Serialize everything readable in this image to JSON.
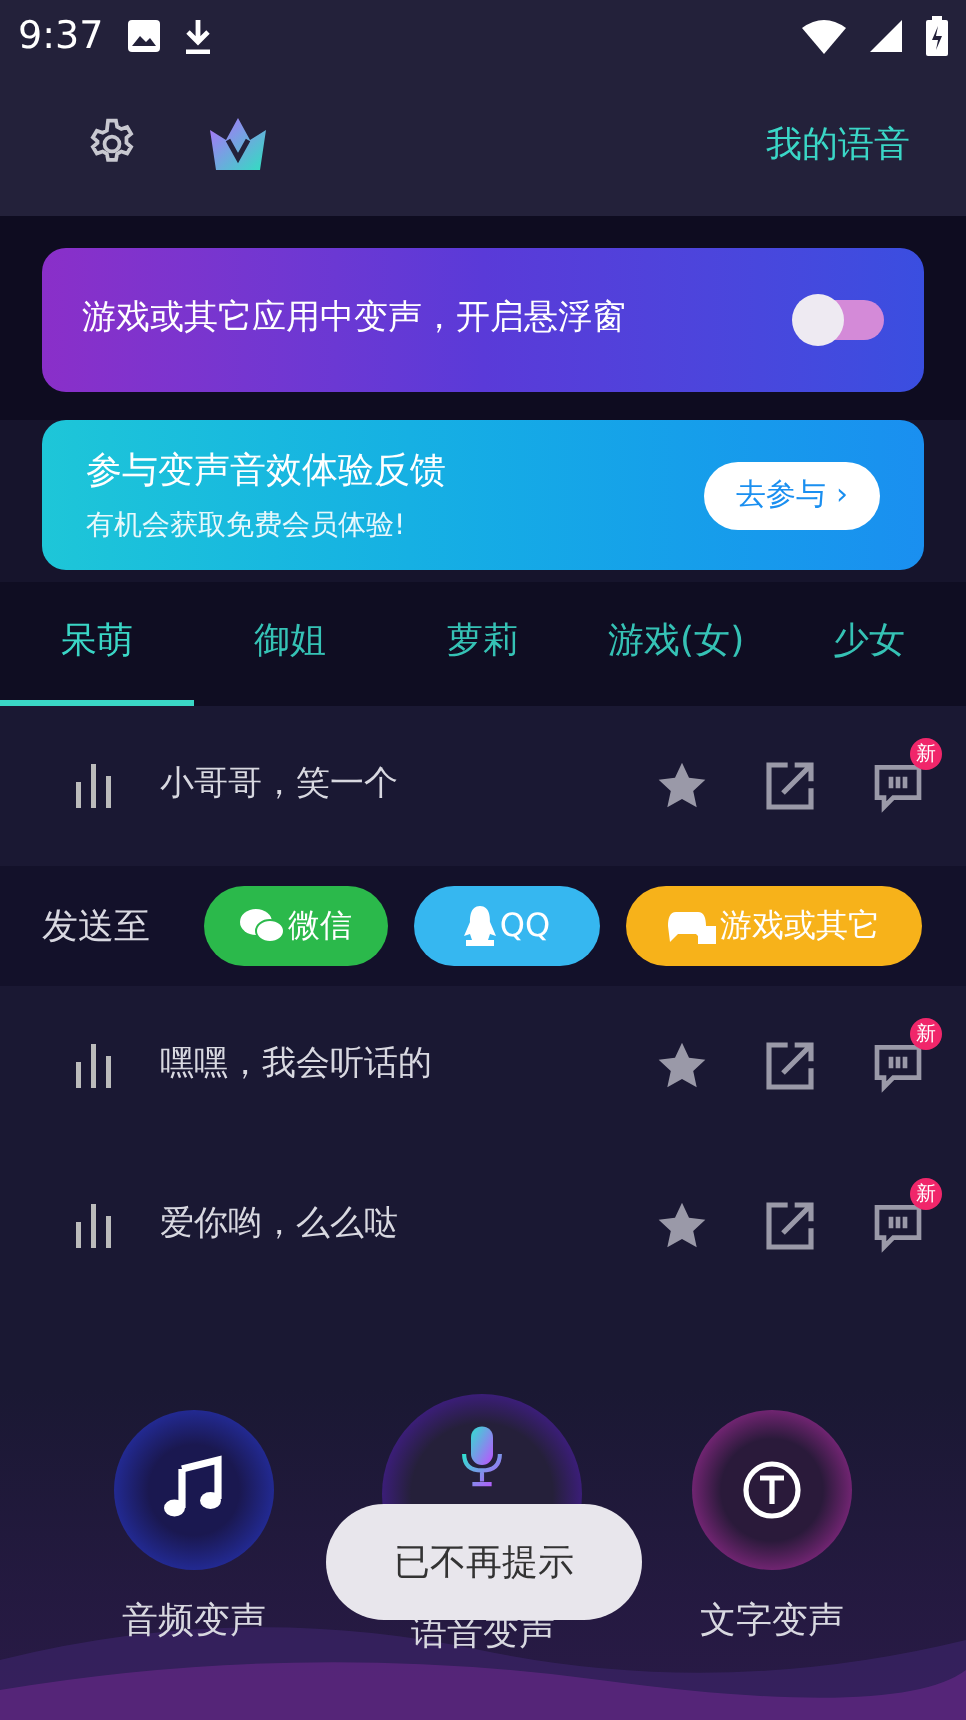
{
  "status_bar": {
    "time": "9:37"
  },
  "header": {
    "my_voice": "我的语音"
  },
  "float_banner": {
    "text": "游戏或其它应用中变声，开启悬浮窗",
    "on": false
  },
  "feedback_banner": {
    "title": "参与变声音效体验反馈",
    "subtitle": "有机会获取免费会员体验!",
    "button": "去参与 ›"
  },
  "tabs": [
    {
      "label": "呆萌",
      "selected": true
    },
    {
      "label": "御姐",
      "selected": false
    },
    {
      "label": "萝莉",
      "selected": false
    },
    {
      "label": "游戏(女)",
      "selected": false
    },
    {
      "label": "少女",
      "selected": false
    }
  ],
  "voices": [
    {
      "text": "小哥哥，笑一个",
      "badge": "新"
    },
    {
      "text": "嘿嘿，我会听话的",
      "badge": "新"
    },
    {
      "text": "爱你哟，么么哒",
      "badge": "新"
    }
  ],
  "send_to": {
    "label": "发送至",
    "targets": [
      {
        "kind": "wechat",
        "label": "微信",
        "color": "#2bb94b"
      },
      {
        "kind": "qq",
        "label": "QQ",
        "color": "#36b7f0"
      },
      {
        "kind": "game",
        "label": "游戏或其它",
        "color": "#f7b21a"
      }
    ]
  },
  "bottom_nav": [
    {
      "kind": "audio",
      "label": "音频变声"
    },
    {
      "kind": "voice",
      "label": "语音变声"
    },
    {
      "kind": "text",
      "label": "文字变声"
    }
  ],
  "toast": "已不再提示"
}
